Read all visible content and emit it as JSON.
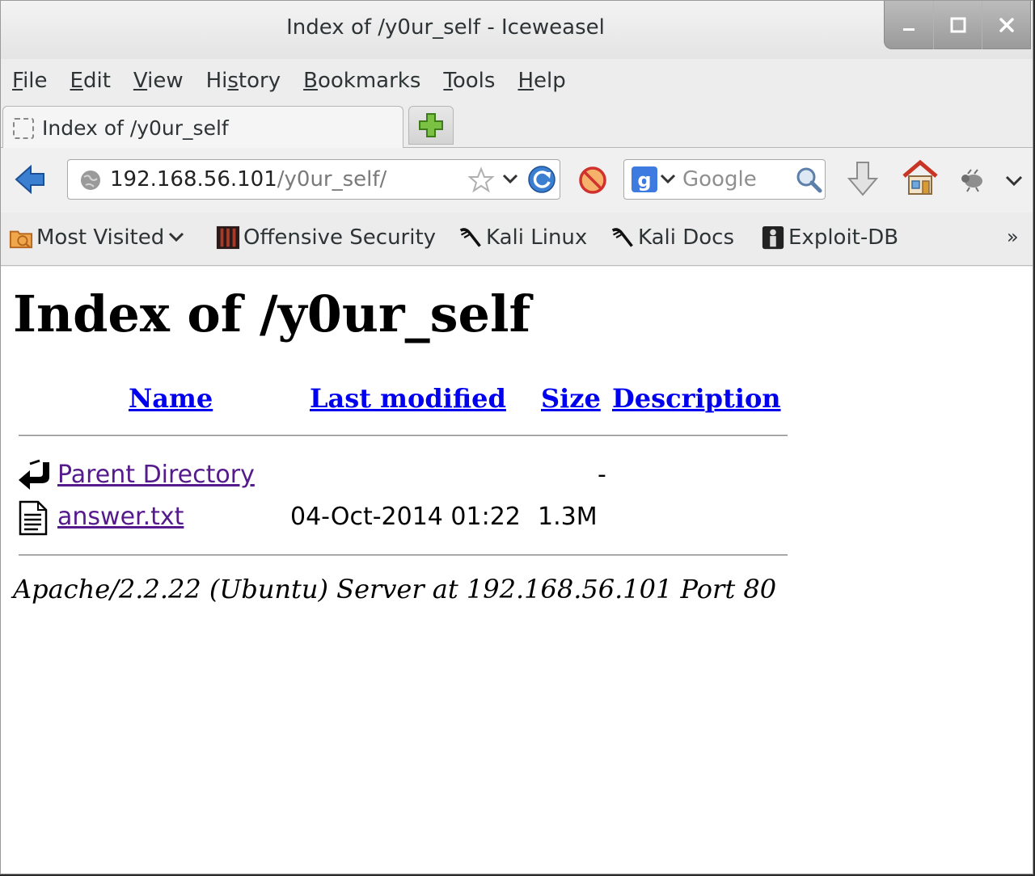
{
  "window": {
    "title": "Index of /y0ur_self - Iceweasel"
  },
  "menubar": {
    "items": [
      {
        "accel": "F",
        "rest": "ile"
      },
      {
        "accel": "E",
        "rest": "dit"
      },
      {
        "accel": "V",
        "rest": "iew"
      },
      {
        "pre": "Hi",
        "accel": "s",
        "rest": "tory"
      },
      {
        "accel": "B",
        "rest": "ookmarks"
      },
      {
        "accel": "T",
        "rest": "ools"
      },
      {
        "accel": "H",
        "rest": "elp"
      }
    ]
  },
  "tabs": [
    {
      "title": "Index of /y0ur_self",
      "active": true
    }
  ],
  "navbar": {
    "url_host": "192.168.56.101",
    "url_path": "/y0ur_self/",
    "search_placeholder": "Google"
  },
  "bookmarks": [
    {
      "label": "Most Visited",
      "icon": "most-visited-folder-icon",
      "dropdown": true
    },
    {
      "label": "Offensive Security",
      "icon": "offensive-security-icon"
    },
    {
      "label": "Kali Linux",
      "icon": "kali-dragon-icon"
    },
    {
      "label": "Kali Docs",
      "icon": "kali-dragon-icon"
    },
    {
      "label": "Exploit-DB",
      "icon": "exploit-db-icon"
    }
  ],
  "bookmarks_overflow": "»",
  "page": {
    "heading": "Index of /y0ur_self",
    "columns": {
      "name": "Name",
      "last_modified": "Last modified",
      "size": "Size",
      "description": "Description"
    },
    "rows": [
      {
        "icon": "parent-directory-icon",
        "name": "Parent Directory",
        "last_modified": "",
        "size": "-",
        "description": ""
      },
      {
        "icon": "text-file-icon",
        "name": "answer.txt",
        "last_modified": "04-Oct-2014 01:22",
        "size": "1.3M",
        "description": ""
      }
    ],
    "address": "Apache/2.2.22 (Ubuntu) Server at 192.168.56.101 Port 80"
  }
}
